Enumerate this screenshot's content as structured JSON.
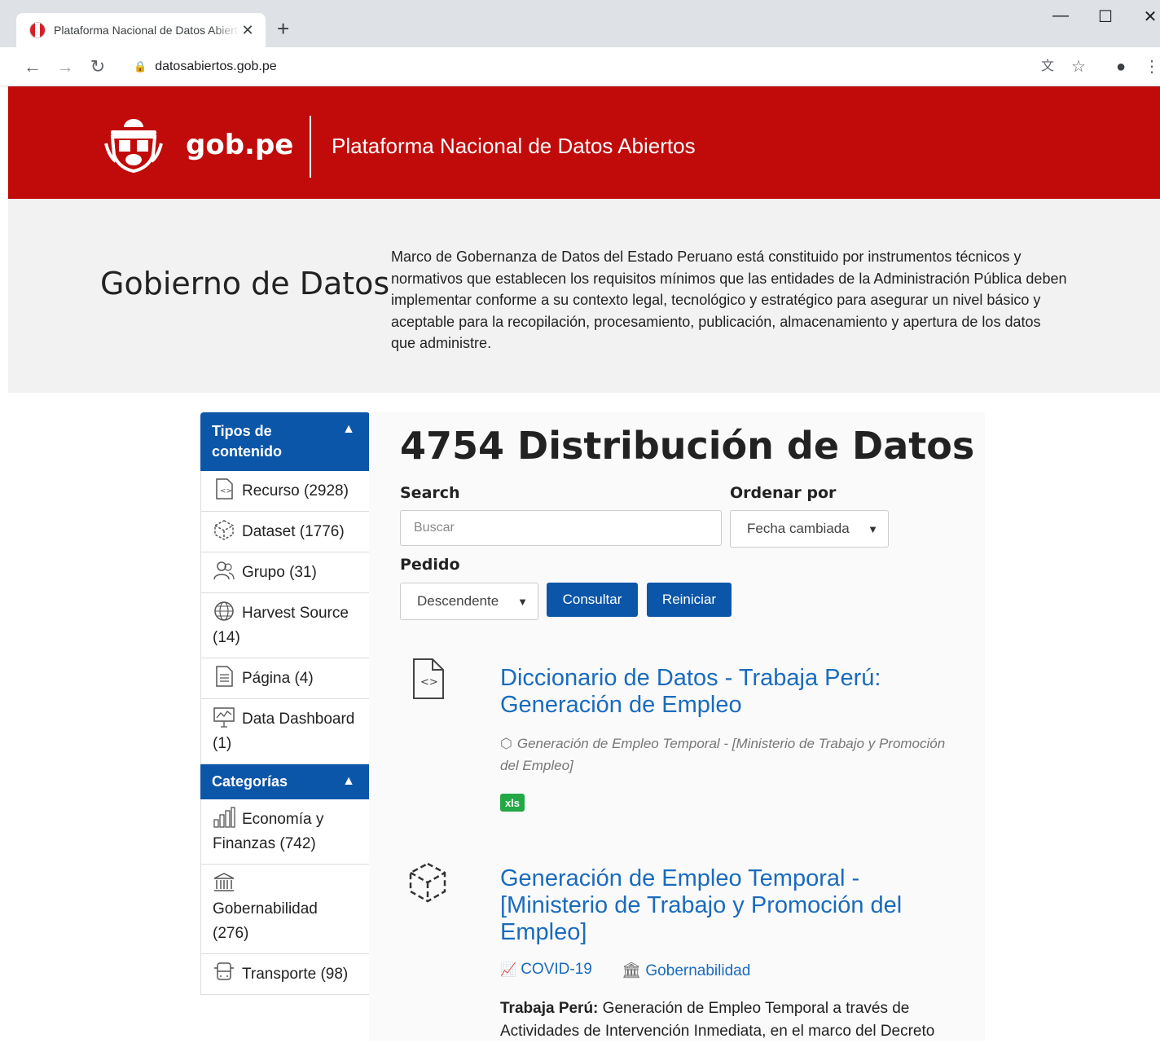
{
  "browser": {
    "tab_title": "Plataforma Nacional de Datos Abiertos",
    "new_tab": "+",
    "url": "datosabiertos.gob.pe"
  },
  "header": {
    "logo_text": "gob.pe",
    "site_title": "Plataforma Nacional de Datos Abiertos"
  },
  "hero": {
    "title": "Gobierno de Datos",
    "text": "Marco de Gobernanza de Datos del Estado Peruano está constituido por instrumentos técnicos y normativos que establecen los requisitos mínimos que las entidades de la Administración Pública deben implementar conforme a su contexto legal, tecnológico y estratégico para asegurar un nivel básico y aceptable para la recopilación, procesamiento, publicación, almacenamiento y apertura de los datos que administre."
  },
  "sidebar": {
    "content_types_title": "Tipos de contenido",
    "content_types": [
      {
        "label": "Recurso (2928)",
        "icon": "code-file-icon"
      },
      {
        "label": "Dataset (1776)",
        "icon": "cube-icon"
      },
      {
        "label": "Grupo (31)",
        "icon": "group-icon"
      },
      {
        "label": "Harvest Source (14)",
        "icon": "globe-icon"
      },
      {
        "label": "Página (4)",
        "icon": "page-icon"
      },
      {
        "label": "Data Dashboard (1)",
        "icon": "dashboard-icon"
      }
    ],
    "categories_title": "Categorías",
    "categories": [
      {
        "label": "Economía y Finanzas (742)",
        "icon": "bar-chart-icon"
      },
      {
        "label": "Gobernabilidad (276)",
        "icon": "government-building-icon"
      },
      {
        "label": "Transporte (98)",
        "icon": "bus-icon"
      }
    ]
  },
  "main": {
    "title": "4754 Distribución de Datos",
    "search_label": "Search",
    "search_placeholder": "Buscar",
    "order_by_label": "Ordenar por",
    "order_by_value": "Fecha cambiada",
    "order_label": "Pedido",
    "order_value": "Descendente",
    "submit_button": "Consultar",
    "reset_button": "Reiniciar"
  },
  "results": [
    {
      "title": "Diccionario de Datos - Trabaja Perú: Generación de Empleo",
      "meta": "Generación de Empleo Temporal - [Ministerio de Trabajo y Promoción del Empleo]",
      "format": "xls",
      "icon": "code-file-icon"
    },
    {
      "title": "Generación de Empleo Temporal - [Ministerio de Trabajo y Promoción del Empleo]",
      "tags": [
        "COVID-19",
        "Gobernabilidad"
      ],
      "desc_bold": "Trabaja Perú:",
      "desc": " Generación de Empleo Temporal a través de Actividades de Intervención Inmediata, en el marco del Decreto",
      "icon": "cube-icon"
    }
  ],
  "colors": {
    "header_red": "#c10a0a",
    "primary_blue": "#0b56a8",
    "link_blue": "#1a6bbd",
    "xls_green": "#22a845"
  }
}
